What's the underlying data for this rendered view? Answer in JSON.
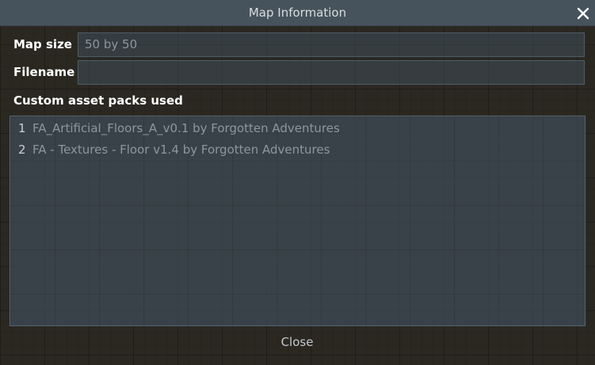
{
  "window": {
    "title": "Map Information"
  },
  "fields": {
    "map_size": {
      "label": "Map size",
      "placeholder": "50 by 50",
      "value": ""
    },
    "filename": {
      "label": "Filename",
      "value": ""
    }
  },
  "asset_packs": {
    "heading": "Custom asset packs used",
    "items": [
      {
        "num": "1",
        "text": "FA_Artificial_Floors_A_v0.1 by Forgotten Adventures"
      },
      {
        "num": "2",
        "text": "FA - Textures - Floor v1.4 by Forgotten Adventures"
      }
    ]
  },
  "footer": {
    "close_label": "Close"
  },
  "icons": {
    "close": "close-icon"
  },
  "colors": {
    "titlebar": "#46535c",
    "background": "#2b2822",
    "text_dim": "#8c969e",
    "text_bright": "#ffffff"
  }
}
